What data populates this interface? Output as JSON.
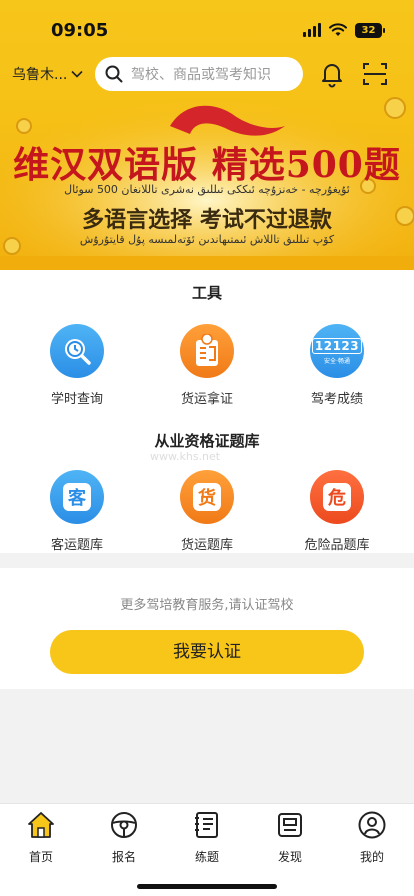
{
  "status": {
    "time": "09:05",
    "battery": "32"
  },
  "header": {
    "city": "乌鲁木...",
    "search_placeholder": "驾校、商品或驾考知识"
  },
  "banner": {
    "title": "维汉双语版 精选500题",
    "uyghur_line1": "ئۇيغۇرچە - خەنزۇچە ئىككى تىللىق نەشرى تاللانغان 500 سوئال",
    "subtitle": "多语言选择 考试不过退款",
    "uyghur_line2": "كۆپ تىللىق تاللاش ئىمتىھاندىن ئۆتەلمىسە پۇل قايتۇرۇش"
  },
  "tools": {
    "title": "工具",
    "items": [
      {
        "label": "学时查询",
        "icon": "clock-search-icon"
      },
      {
        "label": "货运拿证",
        "icon": "freight-license-icon"
      },
      {
        "label": "驾考成绩",
        "icon": "12123-icon",
        "badge_text": "12123",
        "badge_sub": "安全·畅通"
      }
    ]
  },
  "question_bank": {
    "title": "从业资格证题库",
    "items": [
      {
        "label": "客运题库",
        "glyph": "客"
      },
      {
        "label": "货运题库",
        "glyph": "货"
      },
      {
        "label": "危险品题库",
        "glyph": "危"
      }
    ]
  },
  "certify": {
    "hint": "更多驾培教育服务,请认证驾校",
    "button": "我要认证"
  },
  "watermark": "www.khs.net",
  "tabbar": [
    {
      "label": "首页",
      "icon": "home-icon"
    },
    {
      "label": "报名",
      "icon": "steering-wheel-icon"
    },
    {
      "label": "练题",
      "icon": "notebook-icon"
    },
    {
      "label": "发现",
      "icon": "discover-icon"
    },
    {
      "label": "我的",
      "icon": "user-icon"
    }
  ],
  "colors": {
    "brand_yellow": "#f7c61b",
    "banner_red": "#c4161c",
    "blue": "#2b8ee6",
    "orange": "#f07a17",
    "red": "#ec4a1e"
  }
}
